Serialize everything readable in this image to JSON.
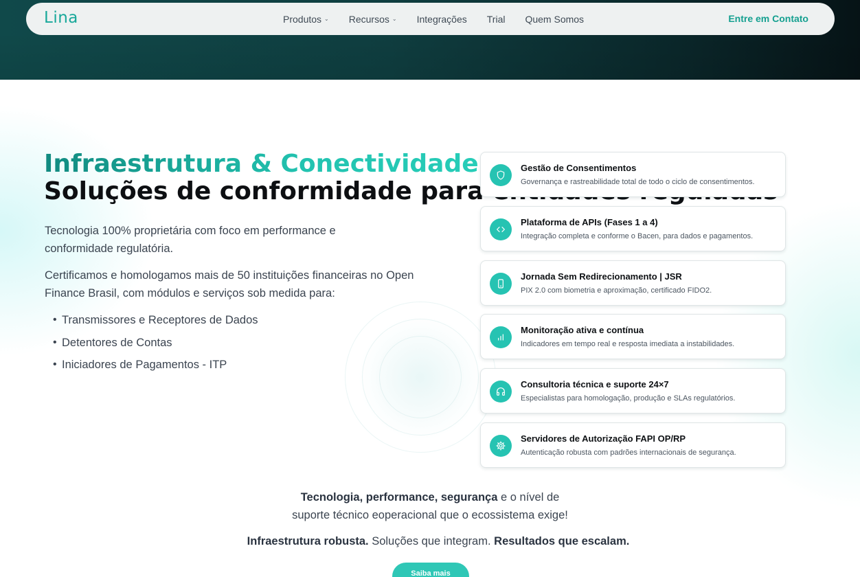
{
  "nav": {
    "logo": "Lina",
    "links": [
      {
        "label": "Produtos",
        "dropdown": true
      },
      {
        "label": "Recursos",
        "dropdown": true
      },
      {
        "label": "Integrações",
        "dropdown": false
      },
      {
        "label": "Trial",
        "dropdown": false
      },
      {
        "label": "Quem Somos",
        "dropdown": false
      }
    ],
    "chevron": "⌄",
    "contact": "Entre em Contato"
  },
  "hero": {
    "title": "Infraestrutura & Conectividade",
    "subtitle": "Soluções de conformidade para entidades reguladas",
    "paragraph1": "Tecnologia 100% proprietária com foco em performance e conformidade regulatória.",
    "paragraph2": "Certificamos e homologamos mais de 50 instituições financeiras no Open Finance Brasil, com módulos e serviços sob medida para:",
    "bullets": [
      "Transmissores e Receptores de Dados",
      "Detentores de Contas",
      "Iniciadores de Pagamentos - ITP"
    ]
  },
  "features": [
    {
      "icon": "shield-icon",
      "title": "Gestão de Consentimentos",
      "description": "Governança e rastreabilidade total de todo o ciclo de consentimentos."
    },
    {
      "icon": "code-icon",
      "title": "Plataforma de APIs (Fases 1 a 4)",
      "description": "Integração completa e conforme o Bacen, para dados e pagamentos."
    },
    {
      "icon": "smartphone-icon",
      "title": "Jornada Sem Redirecionamento | JSR",
      "description": "PIX 2.0 com biometria e aproximação, certificado FIDO2."
    },
    {
      "icon": "bar-chart-icon",
      "title": "Monitoração ativa e contínua",
      "description": "Indicadores em tempo real e resposta imediata a instabilidades."
    },
    {
      "icon": "headphones-icon",
      "title": "Consultoria técnica e suporte 24×7",
      "description": "Especialistas para homologação, produção e SLAs regulatórios."
    },
    {
      "icon": "settings-icon",
      "title": "Servidores de Autorização FAPI OP/RP",
      "description": "Autenticação robusta com padrões internacionais de segurança."
    }
  ],
  "bottom": {
    "tech": "Tecnologia",
    "sep1": ", ",
    "performance": "performance",
    "sep2": ", ",
    "security": "segurança",
    "rest1": " e o nível de",
    "line2": "suporte técnico eoperacional que o ecossistema exige!",
    "infra": "Infraestrutura robusta.",
    "integrate": " Soluções que integram. ",
    "results": "Resultados que escalam.",
    "cta": "Saiba mais"
  },
  "colors": {
    "accent": "#26c3b2",
    "brand_teal": "#17a89a",
    "hero_band": "#0f3e40"
  }
}
